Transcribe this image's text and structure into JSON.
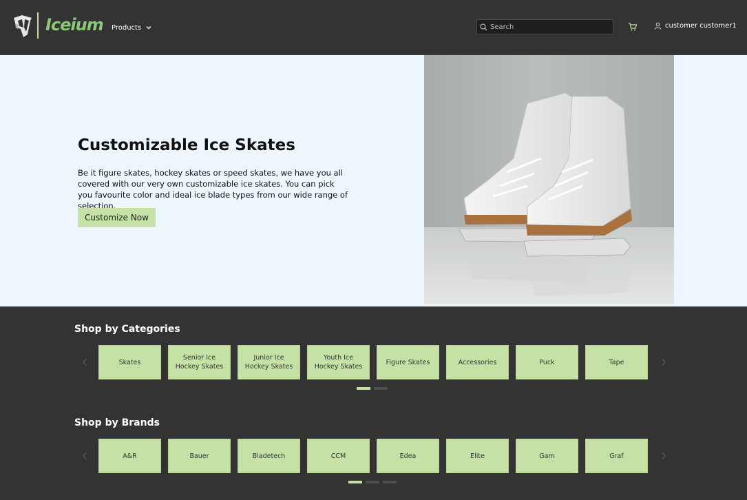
{
  "header": {
    "brand": "Iceium",
    "nav": {
      "products_label": "Products"
    },
    "search": {
      "placeholder": "Search",
      "value": ""
    },
    "user": {
      "name": "customer customer1"
    }
  },
  "hero": {
    "title": "Customizable Ice Skates",
    "text": "Be it figure skates, hockey skates or speed skates, we have you all covered with our very own customizable ice skates. You can pick you favourite color and ideal ice blade types from our wide range of selection.",
    "cta_label": "Customize Now"
  },
  "categories": {
    "title": "Shop by Categories",
    "items": [
      "Skates",
      "Senior Ice Hockey Skates",
      "Junior Ice Hockey Skates",
      "Youth Ice Hockey Skates",
      "Figure Skates",
      "Accessories",
      "Puck",
      "Tape"
    ],
    "page_count": 2,
    "active_page": 1
  },
  "brands": {
    "title": "Shop by Brands",
    "items": [
      "A&R",
      "Bauer",
      "Bladetech",
      "CCM",
      "Edea",
      "Elite",
      "Gam",
      "Graf"
    ],
    "page_count": 3,
    "active_page": 1
  },
  "icons": {
    "logo": "iceium-logo-icon",
    "products_chevron": "chevron-down-icon",
    "search": "search-icon",
    "cart": "cart-icon",
    "user": "user-icon",
    "prev": "chevron-left-icon",
    "next": "chevron-right-icon"
  },
  "colors": {
    "header_bg": "#333333",
    "hero_bg": "#eef6fe",
    "accent": "#c5e1a5",
    "brand_green": "#8bc87a",
    "body_bg": "#333333"
  }
}
